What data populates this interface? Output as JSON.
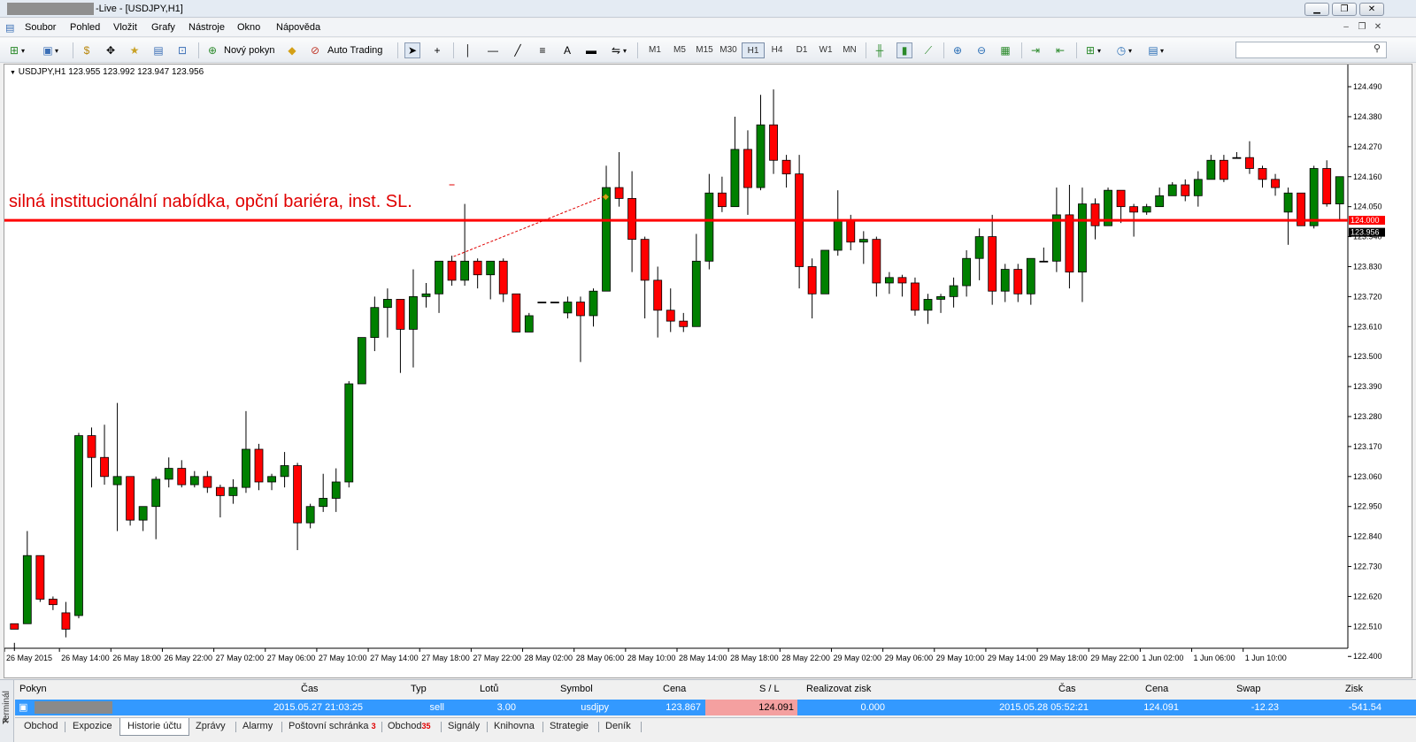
{
  "window": {
    "title": "-Live - [USDJPY,H1]"
  },
  "menu": [
    "Soubor",
    "Pohled",
    "Vložit",
    "Grafy",
    "Nástroje",
    "Okno",
    "Nápověda"
  ],
  "toolbar": {
    "new_order": "Nový pokyn",
    "auto_trading": "Auto Trading",
    "letter_a": "A",
    "timeframes": [
      "M1",
      "M5",
      "M15",
      "M30",
      "H1",
      "H4",
      "D1",
      "W1",
      "MN"
    ],
    "active_timeframe": "H1"
  },
  "chart_data": {
    "type": "candlestick",
    "symbol_header": "USDJPY,H1  123.955 123.992 123.947 123.956",
    "annotation": "silná institucionální nabídka, opční bariéra, inst. SL.",
    "horizontal_line": {
      "value": 124.0,
      "label": "124.000",
      "color": "#ff0000"
    },
    "last_price": {
      "value": 123.956,
      "label": "123.956"
    },
    "ylim": [
      122.43,
      124.555
    ],
    "yticks": [
      "124.490",
      "124.380",
      "124.270",
      "124.160",
      "124.050",
      "123.940",
      "123.830",
      "123.720",
      "123.610",
      "123.500",
      "123.390",
      "123.280",
      "123.170",
      "123.060",
      "122.950",
      "122.840",
      "122.730",
      "122.620",
      "122.510",
      "122.400"
    ],
    "xticks": [
      "26 May 2015",
      "26 May 14:00",
      "26 May 18:00",
      "26 May 22:00",
      "27 May 02:00",
      "27 May 06:00",
      "27 May 10:00",
      "27 May 14:00",
      "27 May 18:00",
      "27 May 22:00",
      "28 May 02:00",
      "28 May 06:00",
      "28 May 10:00",
      "28 May 14:00",
      "28 May 18:00",
      "28 May 22:00",
      "29 May 02:00",
      "29 May 06:00",
      "29 May 10:00",
      "29 May 14:00",
      "29 May 18:00",
      "29 May 22:00",
      "1 Jun 02:00",
      "1 Jun 06:00",
      "1 Jun 10:00"
    ],
    "up_color": "#008000",
    "down_color": "#ff0000",
    "candles": [
      [
        122.52,
        122.5,
        122.45,
        122.42
      ],
      [
        122.52,
        122.77,
        122.86,
        122.52
      ],
      [
        122.77,
        122.61,
        122.77,
        122.6
      ],
      [
        122.61,
        122.59,
        122.62,
        122.57
      ],
      [
        122.56,
        122.5,
        122.6,
        122.47
      ],
      [
        122.55,
        123.21,
        123.22,
        122.54
      ],
      [
        123.21,
        123.13,
        123.24,
        123.02
      ],
      [
        123.13,
        123.06,
        123.25,
        123.03
      ],
      [
        123.03,
        123.06,
        123.33,
        122.86
      ],
      [
        123.06,
        122.9,
        123.06,
        122.88
      ],
      [
        122.9,
        122.95,
        122.95,
        122.86
      ],
      [
        122.95,
        123.05,
        123.06,
        122.83
      ],
      [
        123.05,
        123.09,
        123.13,
        123.02
      ],
      [
        123.09,
        123.03,
        123.12,
        123.02
      ],
      [
        123.03,
        123.06,
        123.08,
        123.02
      ],
      [
        123.06,
        123.02,
        123.08,
        123.0
      ],
      [
        123.02,
        122.99,
        123.03,
        122.91
      ],
      [
        122.99,
        123.02,
        123.05,
        122.96
      ],
      [
        123.02,
        123.16,
        123.3,
        123.0
      ],
      [
        123.16,
        123.04,
        123.18,
        123.01
      ],
      [
        123.04,
        123.06,
        123.07,
        123.01
      ],
      [
        123.06,
        123.1,
        123.15,
        123.02
      ],
      [
        123.1,
        122.89,
        123.11,
        122.79
      ],
      [
        122.89,
        122.95,
        122.96,
        122.87
      ],
      [
        122.95,
        122.98,
        123.07,
        122.93
      ],
      [
        122.98,
        123.04,
        123.09,
        122.93
      ],
      [
        123.04,
        123.4,
        123.41,
        123.02
      ],
      [
        123.4,
        123.57,
        123.57,
        123.4
      ],
      [
        123.57,
        123.68,
        123.72,
        123.52
      ],
      [
        123.68,
        123.71,
        123.75,
        123.57
      ],
      [
        123.71,
        123.6,
        123.71,
        123.44
      ],
      [
        123.6,
        123.72,
        123.82,
        123.46
      ],
      [
        123.72,
        123.73,
        123.77,
        123.68
      ],
      [
        123.73,
        123.85,
        123.85,
        123.66
      ],
      [
        123.85,
        123.78,
        123.87,
        123.76
      ],
      [
        123.78,
        123.85,
        124.06,
        123.76
      ],
      [
        123.85,
        123.8,
        123.86,
        123.75
      ],
      [
        123.8,
        123.85,
        123.85,
        123.71
      ],
      [
        123.85,
        123.73,
        123.86,
        123.7
      ],
      [
        123.73,
        123.59,
        123.73,
        123.59
      ],
      [
        123.59,
        123.65,
        123.66,
        123.62
      ],
      [
        123.7,
        123.7,
        123.7,
        123.7
      ],
      [
        123.7,
        123.7,
        123.7,
        123.7
      ],
      [
        123.66,
        123.7,
        123.72,
        123.64
      ],
      [
        123.7,
        123.65,
        123.72,
        123.48
      ],
      [
        123.65,
        123.74,
        123.75,
        123.61
      ],
      [
        123.74,
        124.12,
        124.2,
        123.74
      ],
      [
        124.12,
        124.08,
        124.25,
        124.05
      ],
      [
        124.08,
        123.93,
        124.18,
        123.81
      ],
      [
        123.93,
        123.78,
        123.94,
        123.64
      ],
      [
        123.78,
        123.67,
        123.83,
        123.57
      ],
      [
        123.67,
        123.63,
        123.75,
        123.59
      ],
      [
        123.63,
        123.61,
        123.66,
        123.59
      ],
      [
        123.61,
        123.85,
        123.95,
        123.61
      ],
      [
        123.85,
        124.1,
        124.17,
        123.82
      ],
      [
        124.1,
        124.05,
        124.16,
        124.03
      ],
      [
        124.05,
        124.26,
        124.38,
        124.05
      ],
      [
        124.26,
        124.12,
        124.33,
        124.02
      ],
      [
        124.12,
        124.35,
        124.46,
        124.11
      ],
      [
        124.35,
        124.22,
        124.48,
        124.17
      ],
      [
        124.22,
        124.17,
        124.24,
        124.12
      ],
      [
        124.17,
        123.83,
        124.24,
        123.75
      ],
      [
        123.83,
        123.73,
        123.86,
        123.64
      ],
      [
        123.73,
        123.89,
        123.89,
        123.73
      ],
      [
        123.89,
        124.0,
        124.11,
        123.87
      ],
      [
        124.0,
        123.92,
        124.02,
        123.89
      ],
      [
        123.92,
        123.93,
        123.96,
        123.84
      ],
      [
        123.93,
        123.77,
        123.94,
        123.72
      ],
      [
        123.77,
        123.79,
        123.81,
        123.73
      ],
      [
        123.79,
        123.77,
        123.8,
        123.72
      ],
      [
        123.77,
        123.67,
        123.79,
        123.65
      ],
      [
        123.67,
        123.71,
        123.73,
        123.62
      ],
      [
        123.71,
        123.72,
        123.73,
        123.66
      ],
      [
        123.72,
        123.76,
        123.79,
        123.68
      ],
      [
        123.76,
        123.86,
        123.89,
        123.72
      ],
      [
        123.86,
        123.94,
        123.97,
        123.78
      ],
      [
        123.94,
        123.74,
        124.02,
        123.69
      ],
      [
        123.74,
        123.82,
        123.84,
        123.7
      ],
      [
        123.82,
        123.73,
        123.84,
        123.7
      ],
      [
        123.73,
        123.86,
        123.86,
        123.69
      ],
      [
        123.85,
        123.85,
        123.9,
        123.85
      ],
      [
        123.85,
        124.02,
        124.12,
        123.81
      ],
      [
        124.02,
        123.81,
        124.13,
        123.75
      ],
      [
        123.81,
        124.06,
        124.12,
        123.7
      ],
      [
        124.06,
        123.98,
        124.08,
        123.93
      ],
      [
        123.98,
        124.11,
        124.12,
        123.98
      ],
      [
        124.11,
        124.05,
        124.11,
        123.99
      ],
      [
        124.05,
        124.03,
        124.06,
        123.94
      ],
      [
        124.03,
        124.05,
        124.06,
        124.02
      ],
      [
        124.05,
        124.09,
        124.12,
        124.05
      ],
      [
        124.09,
        124.13,
        124.14,
        124.09
      ],
      [
        124.13,
        124.09,
        124.15,
        124.07
      ],
      [
        124.09,
        124.15,
        124.18,
        124.05
      ],
      [
        124.15,
        124.22,
        124.24,
        124.16
      ],
      [
        124.22,
        124.15,
        124.24,
        124.14
      ],
      [
        124.23,
        124.23,
        124.25,
        124.23
      ],
      [
        124.23,
        124.19,
        124.29,
        124.17
      ],
      [
        124.19,
        124.15,
        124.2,
        124.12
      ],
      [
        124.15,
        124.12,
        124.17,
        124.09
      ],
      [
        124.03,
        124.1,
        124.12,
        123.91
      ],
      [
        124.1,
        123.98,
        124.1,
        123.98
      ],
      [
        123.98,
        124.19,
        124.2,
        123.97
      ],
      [
        124.19,
        124.06,
        124.22,
        124.05
      ],
      [
        124.06,
        124.16,
        124.16,
        124.0
      ]
    ]
  },
  "terminal": {
    "side_label": "Terminál",
    "headers": {
      "pokyn": "Pokyn",
      "cas": "Čas",
      "typ": "Typ",
      "lotu": "Lotů",
      "symbol": "Symbol",
      "cena": "Cena",
      "sl": "S / L",
      "realizovat": "Realizovat zisk",
      "cas2": "Čas",
      "cena2": "Cena",
      "swap": "Swap",
      "zisk": "Zisk"
    },
    "row": {
      "cas": "2015.05.27 21:03:25",
      "typ": "sell",
      "lotu": "3.00",
      "symbol": "usdjpy",
      "cena": "123.867",
      "sl": "124.091",
      "realizovat": "0.000",
      "cas2": "2015.05.28 05:52:21",
      "cena2": "124.091",
      "swap": "-12.23",
      "zisk": "-541.54"
    },
    "tabs": [
      "Obchod",
      "Expozice",
      "Historie účtu",
      "Zprávy",
      "Alarmy",
      "Poštovní schránka",
      "Obchod",
      "Signály",
      "Knihovna",
      "Strategie",
      "Deník"
    ],
    "tab_counts": {
      "mailbox": "3",
      "market": "35"
    },
    "active_tab": "Historie účtu"
  }
}
